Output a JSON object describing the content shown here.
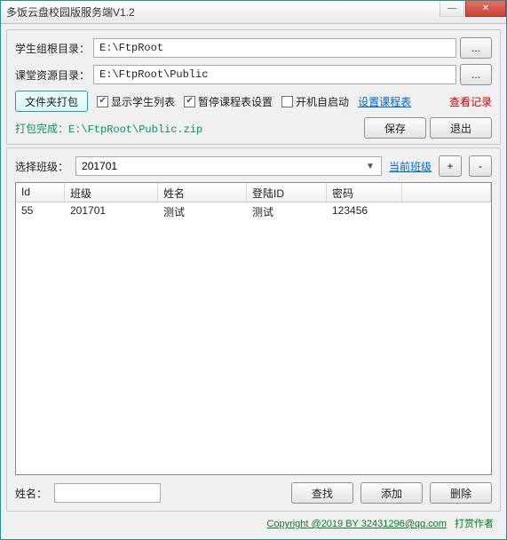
{
  "window": {
    "title": "多饭云盘校园版服务端V1.2"
  },
  "top": {
    "root_label": "学生组根目录：",
    "root_value": "E:\\FtpRoot",
    "res_label": "课堂资源目录：",
    "res_value": "E:\\FtpRoot\\Public",
    "browse": "...",
    "pack_btn": "文件夹打包",
    "chk_show_list": "显示学生列表",
    "chk_pause": "暂停课程表设置",
    "chk_autostart": "开机自启动",
    "link_schedule": "设置课程表",
    "link_viewlog": "查看记录",
    "status": "打包完成：E:\\FtpRoot\\Public.zip",
    "save": "保存",
    "exit": "退出"
  },
  "mid": {
    "class_label": "选择班级：",
    "class_value": "201701",
    "current_class": "当前班级",
    "plus": "+",
    "minus": "-"
  },
  "table": {
    "headers": {
      "id": "Id",
      "cls": "班级",
      "name": "姓名",
      "lid": "登陆ID",
      "pwd": "密码"
    },
    "rows": [
      {
        "id": "55",
        "cls": "201701",
        "name": "测试",
        "lid": "测试",
        "pwd": "123456"
      }
    ]
  },
  "bottom": {
    "name_label": "姓名：",
    "find": "查找",
    "add": "添加",
    "del": "删除"
  },
  "copyright": {
    "text": "Copyright @2019 BY 32431296@qq.com",
    "tip": "打赏作者"
  }
}
